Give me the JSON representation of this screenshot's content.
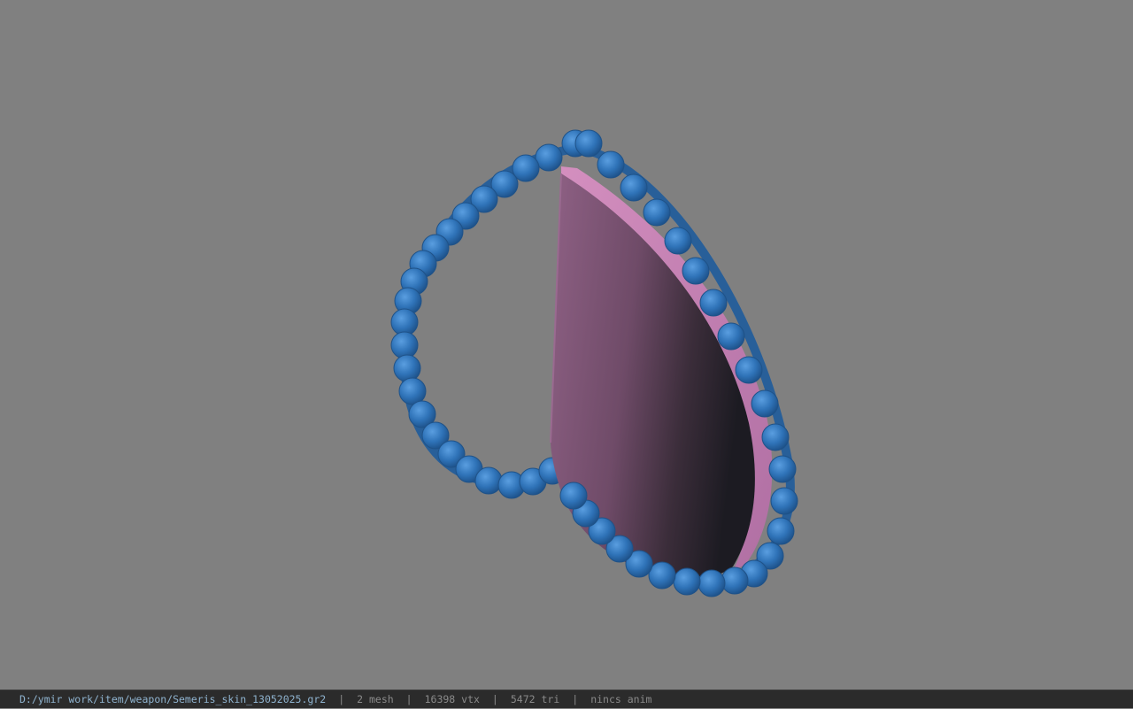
{
  "viewport": {
    "background": "#808080",
    "model": {
      "ring_color": "#2f73b8",
      "bead_color": "#2f73b8",
      "blade_highlight": "#8a5d80",
      "blade_shadow": "#1e1e24",
      "blade_rim": "#c07fb0"
    }
  },
  "statusbar": {
    "path": "D:/ymir work/item/weapon/Semeris_skin_13052025.gr2",
    "separator": "|",
    "mesh": "2 mesh",
    "vtx": "16398 vtx",
    "tri": "5472 tri",
    "anim": "nincs anim"
  }
}
